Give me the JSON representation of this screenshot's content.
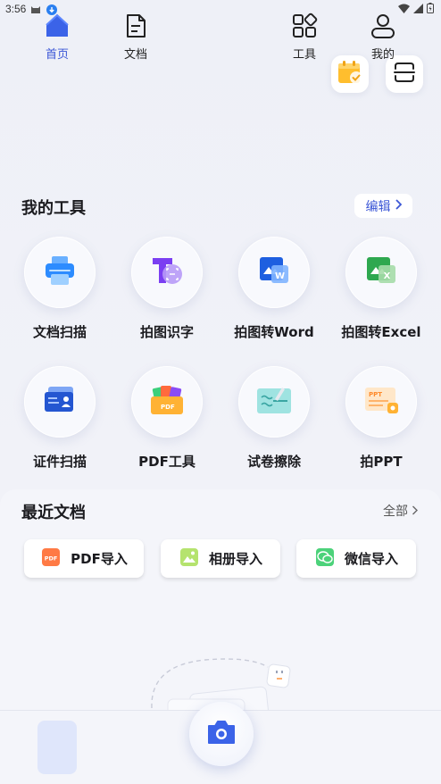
{
  "status_bar": {
    "time": "3:56"
  },
  "tools_section": {
    "title": "我的工具",
    "edit_label": "编辑"
  },
  "tools": [
    {
      "label": "文档扫描",
      "icon": "printer-icon"
    },
    {
      "label": "拍图识字",
      "icon": "text-recognition-icon"
    },
    {
      "label": "拍图转Word",
      "icon": "word-icon"
    },
    {
      "label": "拍图转Excel",
      "icon": "excel-icon"
    },
    {
      "label": "证件扫描",
      "icon": "id-card-icon"
    },
    {
      "label": "PDF工具",
      "icon": "pdf-tools-icon"
    },
    {
      "label": "试卷擦除",
      "icon": "paper-erase-icon"
    },
    {
      "label": "拍PPT",
      "icon": "ppt-icon"
    }
  ],
  "recent_section": {
    "title": "最近文档",
    "all_label": "全部"
  },
  "import_buttons": [
    {
      "label": "PDF导入",
      "icon": "pdf-icon"
    },
    {
      "label": "相册导入",
      "icon": "album-icon"
    },
    {
      "label": "微信导入",
      "icon": "wechat-icon"
    }
  ],
  "bottom_nav": [
    {
      "label": "首页",
      "icon": "home-icon",
      "active": true
    },
    {
      "label": "文档",
      "icon": "document-icon"
    },
    {
      "label": "工具",
      "icon": "tools-grid-icon"
    },
    {
      "label": "我的",
      "icon": "profile-icon"
    }
  ],
  "colors": {
    "accent": "#3b56d6",
    "background": "#eef0f7"
  }
}
